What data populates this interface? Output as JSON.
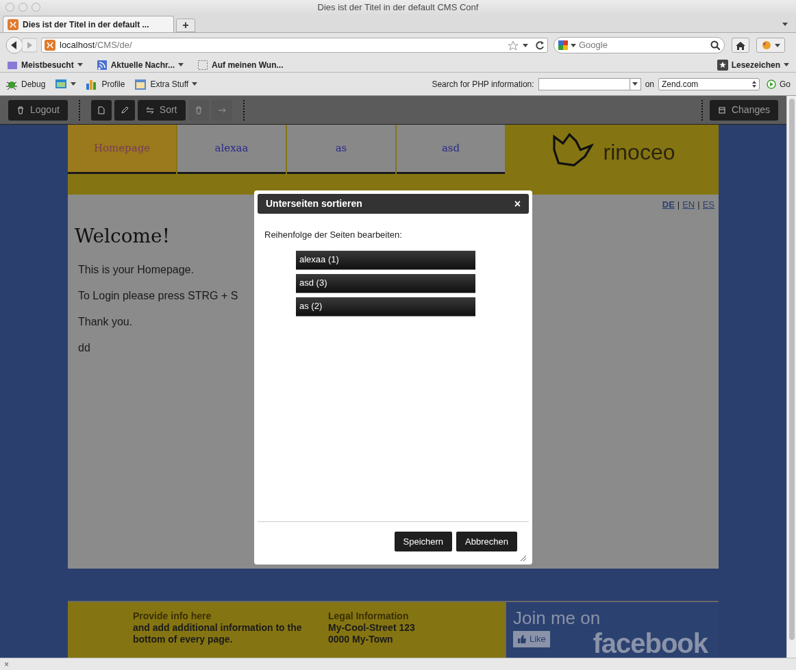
{
  "window": {
    "title": "Dies ist der Titel in der default CMS Conf"
  },
  "tab": {
    "title": "Dies ist der Titel in der default ...",
    "new_tab": "+"
  },
  "address_bar": {
    "host": "localhost",
    "path": "/CMS/de/"
  },
  "search": {
    "placeholder": "Google"
  },
  "bookmarks": [
    {
      "label": "Meistbesucht",
      "menu": true
    },
    {
      "label": "Aktuelle Nachr...",
      "menu": true
    },
    {
      "label": "Auf meinen Wun...",
      "menu": false
    }
  ],
  "bookmarks_menu": "Lesezeichen",
  "php_toolbar": {
    "items": [
      {
        "label": "Debug",
        "kind": "bug"
      },
      {
        "kind": "image"
      },
      {
        "label": "Profile",
        "kind": "chart"
      },
      {
        "label": "Extra Stuff",
        "kind": "calendar"
      }
    ],
    "search_label": "Search for PHP information:",
    "on_label": "on",
    "site": "Zend.com",
    "go": "Go"
  },
  "cms_toolbar": {
    "buttons": [
      {
        "label": "Logout",
        "kind": "trash",
        "disabled": false
      },
      {
        "kind": "page",
        "disabled": false
      },
      {
        "kind": "pencil",
        "disabled": false
      },
      {
        "label": "Sort",
        "kind": "arrows",
        "disabled": false
      },
      {
        "kind": "trash",
        "disabled": true
      },
      {
        "kind": "arrow",
        "disabled": true
      }
    ],
    "changes": "Changes"
  },
  "nav": [
    {
      "label": "Homepage",
      "selected": true
    },
    {
      "label": "alexaa",
      "selected": false
    },
    {
      "label": "as",
      "selected": false
    },
    {
      "label": "asd",
      "selected": false
    }
  ],
  "logo": "rinoceo",
  "language_separator": "|",
  "languages": [
    {
      "label": "DE",
      "selected": true
    },
    {
      "label": "EN",
      "selected": false
    },
    {
      "label": "ES",
      "selected": false
    }
  ],
  "content": {
    "heading": "Welcome!",
    "paragraphs": [
      "This is your Homepage.",
      "To Login please press STRG + S",
      "Thank you.",
      "dd"
    ]
  },
  "dialog": {
    "title": "Unterseiten sortieren",
    "close": "×",
    "instruction": "Reihenfolge der Seiten bearbeiten:",
    "items": [
      "alexaa (1)",
      "asd (3)",
      "as (2)"
    ],
    "buttons": [
      "Speichern",
      "Abbrechen"
    ]
  },
  "footer": {
    "info_title": "Provide info here",
    "info_text": "and add additional information to the bottom of every page.",
    "legal_title": "Legal Information",
    "legal_lines": [
      "My-Cool-Street 123",
      "0000 My-Town"
    ],
    "facebook_join": "Join me on",
    "facebook_like": "Like",
    "facebook_brand": "facebook"
  },
  "status_bar": {
    "close": "×"
  }
}
